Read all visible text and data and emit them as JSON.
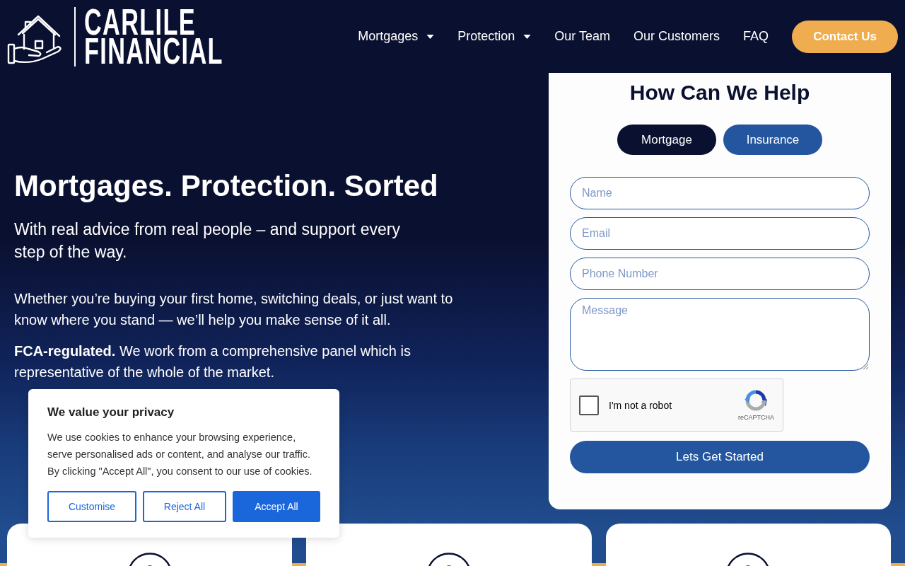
{
  "header": {
    "logo": {
      "line_1": "CARLILE",
      "line_2": "FINANCIAL"
    },
    "nav": [
      {
        "label": "Mortgages",
        "has_menu": true
      },
      {
        "label": "Protection",
        "has_menu": true
      },
      {
        "label": "Our Team",
        "has_menu": false
      },
      {
        "label": "Our Customers",
        "has_menu": false
      },
      {
        "label": "FAQ",
        "has_menu": false
      }
    ],
    "contact_button": "Contact Us"
  },
  "hero": {
    "heading": "Mortgages. Protection. Sorted",
    "subheading": "With real advice from real people – and support every step of the way.",
    "paragraphs": [
      "Whether you’re buying your first home, switching deals, or just want to know where you stand — we’ll help you make sense of it all.",
      "**FCA-regulated.** We work from a comprehensive panel which is representative of the whole of the market."
    ]
  },
  "form": {
    "title": "How Can We Help",
    "tabs": [
      {
        "label": "Mortgage",
        "selected": true
      },
      {
        "label": "Insurance",
        "selected": false
      }
    ],
    "fields": [
      {
        "kind": "input",
        "placeholder": "Name"
      },
      {
        "kind": "input",
        "placeholder": "Email"
      },
      {
        "kind": "input",
        "placeholder": "Phone Number"
      },
      {
        "kind": "textarea",
        "placeholder": "Message"
      }
    ],
    "captcha": {
      "label": "I'm not a robot",
      "checked": false,
      "brand": "reCAPTCHA"
    },
    "submit": "Lets Get Started"
  },
  "cookie_banner": {
    "title": "We value your privacy",
    "text": "We use cookies to enhance your browsing experience, serve personalised ads or content, and analyse our traffic. By clicking \"Accept All\", you consent to our use of cookies.",
    "buttons": [
      {
        "label": "Customise",
        "kind": "outline"
      },
      {
        "label": "Reject All",
        "kind": "outline"
      },
      {
        "label": "Accept All",
        "kind": "primary"
      }
    ]
  }
}
